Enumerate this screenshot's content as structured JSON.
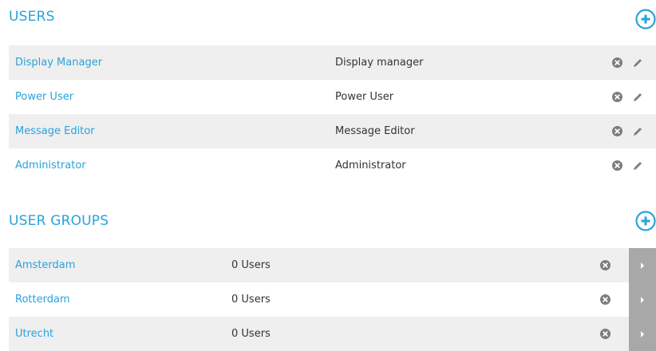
{
  "users_section": {
    "title": "USERS",
    "add_icon": "plus-circle-icon",
    "rows": [
      {
        "name": "Display Manager",
        "role": "Display manager"
      },
      {
        "name": "Power User",
        "role": "Power User"
      },
      {
        "name": "Message Editor",
        "role": "Message Editor"
      },
      {
        "name": "Administrator",
        "role": "Administrator"
      }
    ]
  },
  "groups_section": {
    "title": "USER GROUPS",
    "add_icon": "plus-circle-icon",
    "rows": [
      {
        "name": "Amsterdam",
        "count": "0 Users"
      },
      {
        "name": "Rotterdam",
        "count": "0 Users"
      },
      {
        "name": "Utrecht",
        "count": "0 Users"
      }
    ]
  },
  "colors": {
    "accent": "#29a3db",
    "row_stripe": "#efefef",
    "icon_gray": "#7d7d7d",
    "expand_bg": "#a8a8a8"
  }
}
